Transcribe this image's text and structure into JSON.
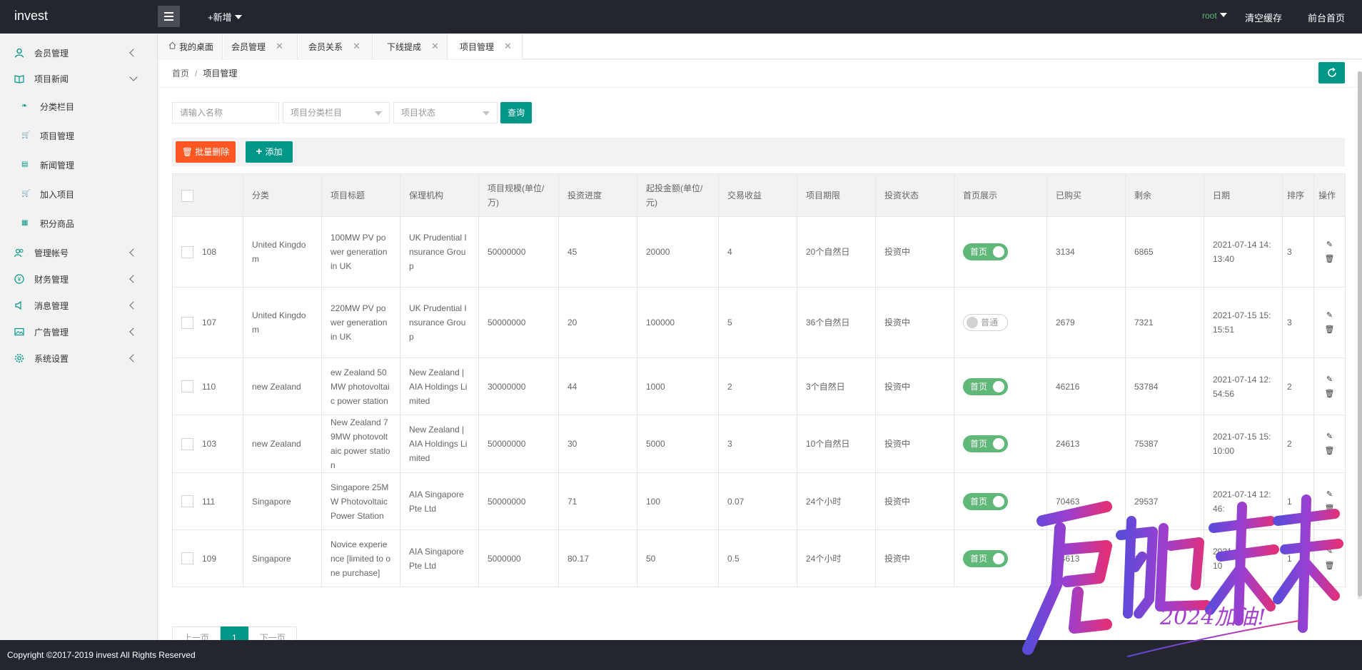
{
  "header": {
    "brand": "invest",
    "add_new": "+新增",
    "user": "root",
    "clear_cache": "清空缓存",
    "front_home": "前台首页"
  },
  "sidebar": {
    "items": [
      {
        "label": "会员管理",
        "icon": "user-icon"
      },
      {
        "label": "项目新闻",
        "icon": "book-icon"
      },
      {
        "label": "管理帐号",
        "icon": "users-icon"
      },
      {
        "label": "财务管理",
        "icon": "finance-icon"
      },
      {
        "label": "消息管理",
        "icon": "speaker-icon"
      },
      {
        "label": "广告管理",
        "icon": "image-icon"
      },
      {
        "label": "系统设置",
        "icon": "gear-icon"
      }
    ],
    "sub_items": [
      {
        "label": "分类栏目"
      },
      {
        "label": "项目管理"
      },
      {
        "label": "新闻管理"
      },
      {
        "label": "加入项目"
      },
      {
        "label": "积分商品"
      }
    ]
  },
  "tabs": [
    "我的桌面",
    "会员管理",
    "会员关系",
    "下线提成",
    "项目管理"
  ],
  "breadcrumb": {
    "home": "首页",
    "sep": "/",
    "current": "项目管理"
  },
  "filters": {
    "name_placeholder": "请输入名称",
    "category_select": "项目分类栏目",
    "status_select": "项目状态",
    "query_label": "查询"
  },
  "toolbar": {
    "batch_delete": "批量删除",
    "add": "添加"
  },
  "table": {
    "headers": [
      "分类",
      "项目标题",
      "保理机构",
      "项目规模(单位/万)",
      "投资进度",
      "起投金额(单位/元)",
      "交易收益",
      "项目期限",
      "投资状态",
      "首页展示",
      "已购买",
      "剩余",
      "日期",
      "排序",
      "操作"
    ],
    "rows": [
      {
        "id": "108",
        "category": "United Kingdom",
        "title": "100MW PV power generation in UK",
        "agency": "UK Prudential Insurance Group",
        "scale": "50000000",
        "progress": "45",
        "min_invest": "20000",
        "yield": "4",
        "term": "20个自然日",
        "status": "投资中",
        "home": "首页",
        "home_on": true,
        "bought": "3134",
        "remain": "6865",
        "date": "2021-07-14 14:13:40",
        "sort": "3"
      },
      {
        "id": "107",
        "category": "United Kingdom",
        "title": "220MW PV power generation in UK",
        "agency": "UK Prudential Insurance Group",
        "scale": "50000000",
        "progress": "20",
        "min_invest": "100000",
        "yield": "5",
        "term": "36个自然日",
        "status": "投资中",
        "home": "普通",
        "home_on": false,
        "bought": "2679",
        "remain": "7321",
        "date": "2021-07-15 15:15:51",
        "sort": "3"
      },
      {
        "id": "110",
        "category": "new Zealand",
        "title": "ew Zealand 50MW photovoltaic power station",
        "agency": "New Zealand | AIA Holdings Limited",
        "scale": "30000000",
        "progress": "44",
        "min_invest": "1000",
        "yield": "2",
        "term": "3个自然日",
        "status": "投资中",
        "home": "首页",
        "home_on": true,
        "bought": "46216",
        "remain": "53784",
        "date": "2021-07-14 12:54:56",
        "sort": "2"
      },
      {
        "id": "103",
        "category": "new Zealand",
        "title": "New Zealand 79MW photovoltaic power station",
        "agency": "New Zealand | AIA Holdings Limited",
        "scale": "50000000",
        "progress": "30",
        "min_invest": "5000",
        "yield": "3",
        "term": "10个自然日",
        "status": "投资中",
        "home": "首页",
        "home_on": true,
        "bought": "24613",
        "remain": "75387",
        "date": "2021-07-15 15:10:00",
        "sort": "2"
      },
      {
        "id": "111",
        "category": "Singapore",
        "title": "Singapore 25MW Photovoltaic Power Station",
        "agency": "AIA Singapore Pte Ltd",
        "scale": "50000000",
        "progress": "71",
        "min_invest": "100",
        "yield": "0.07",
        "term": "24个小时",
        "status": "投资中",
        "home": "首页",
        "home_on": true,
        "bought": "70463",
        "remain": "29537",
        "date": "2021-07-14 12:46:",
        "sort": "1"
      },
      {
        "id": "109",
        "category": "Singapore",
        "title": "Novice experience [limited to one purchase]",
        "agency": "AIA Singapore Pte Ltd",
        "scale": "5000000",
        "progress": "80.17",
        "min_invest": "50",
        "yield": "0.5",
        "term": "24个小时",
        "status": "投资中",
        "home": "首页",
        "home_on": true,
        "bought": "24613",
        "remain": "1",
        "date": "2021-07-15 15:10",
        "sort": "1"
      }
    ]
  },
  "pager": {
    "prev": "上一页",
    "current": "1",
    "next": "下一页"
  },
  "footer": "Copyright ©2017-2019 invest All Rights Reserved",
  "colors": {
    "accent": "#009688",
    "danger": "#FF5722",
    "switch_on": "#5FB878",
    "header_bg": "#23262e"
  }
}
